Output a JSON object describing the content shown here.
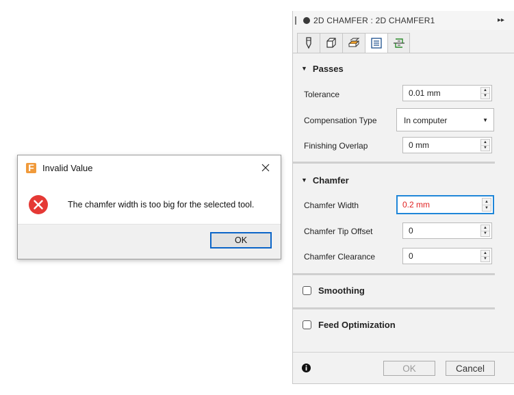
{
  "dialog": {
    "title": "Invalid Value",
    "logo_letter": "F",
    "message": "The chamfer width is too big for the selected tool.",
    "ok_label": "OK"
  },
  "panel": {
    "title": "2D CHAMFER : 2D CHAMFER1",
    "expand_icon": "▸▸",
    "tabs": [
      {
        "icon": "tool-icon"
      },
      {
        "icon": "geometry-icon"
      },
      {
        "icon": "heights-icon"
      },
      {
        "icon": "passes-icon"
      },
      {
        "icon": "linking-icon"
      }
    ],
    "passes": {
      "header": "Passes",
      "tolerance_label": "Tolerance",
      "tolerance_value": "0.01 mm",
      "compensation_label": "Compensation Type",
      "compensation_value": "In computer",
      "finishing_overlap_label": "Finishing Overlap",
      "finishing_overlap_value": "0 mm"
    },
    "chamfer": {
      "header": "Chamfer",
      "width_label": "Chamfer Width",
      "width_value": "0.2 mm",
      "tip_offset_label": "Chamfer Tip Offset",
      "tip_offset_value": "0",
      "clearance_label": "Chamfer Clearance",
      "clearance_value": "0"
    },
    "smoothing_label": "Smoothing",
    "feed_optimization_label": "Feed Optimization",
    "footer": {
      "ok_label": "OK",
      "cancel_label": "Cancel"
    }
  },
  "colors": {
    "accent_blue": "#1f86d8",
    "error_red": "#e53935",
    "invalid_text": "#e02020",
    "logo_orange": "#f09a3b"
  }
}
